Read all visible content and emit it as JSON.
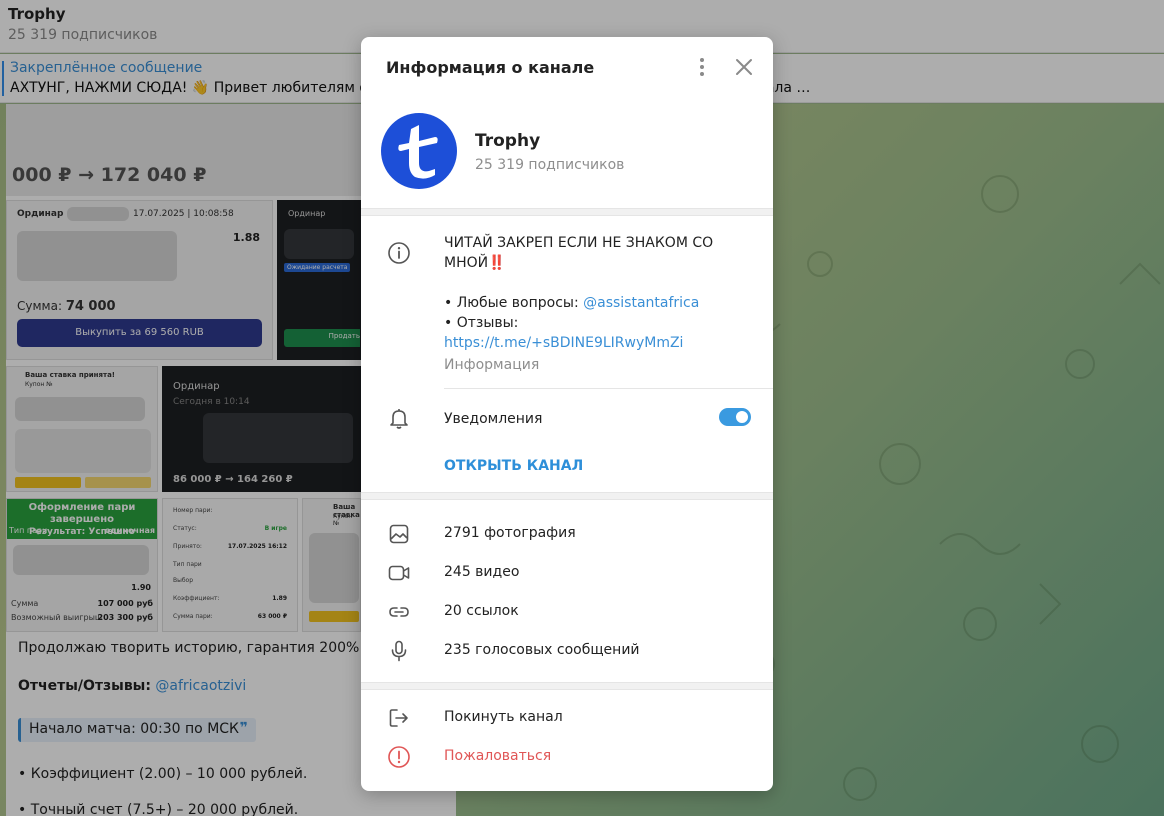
{
  "header": {
    "title": "Trophy",
    "subscribers": "25 319 подписчиков"
  },
  "pinned": {
    "title": "Закреплённое сообщение",
    "text": "АХТУНГ, НАЖМИ СЮДА! 👋 Привет любителям фу… …а. Почему Африканец? Все просто, после скандала …"
  },
  "message": {
    "banner_amount": "000 ₽ → 172 040 ₽",
    "card1": {
      "type": "Ординар",
      "date": "17.07.2025 | 10:08:58",
      "odds": "1.88",
      "sum_label": "Сумма:",
      "sum_value": "74 000",
      "button": "Выкупить за 69 560 RUB"
    },
    "card2": {
      "type": "Ординар",
      "status": "Ожидание расчета",
      "button": "Продать"
    },
    "card3": {
      "title": "Ваша ставка принята!",
      "coupon": "Купон №"
    },
    "card4": {
      "type": "Ординар",
      "date": "Сегодня в 10:14",
      "amount": "86 000 ₽ → 164 260 ₽"
    },
    "card5": {
      "head": "Оформление пари завершено",
      "result_label": "Результат:",
      "result_value": "Успешно",
      "bet_type_label": "Тип пари",
      "bet_type_value": "одиночная",
      "odds": "1.90",
      "sum_label": "Сумма",
      "sum_value": "107 000 руб",
      "win_label": "Возможный выигрыш",
      "win_value": "203 300 руб"
    },
    "card6": {
      "number_label": "Номер пари:",
      "status_label": "Статус:",
      "status_value": "В игре",
      "accepted_label": "Принято:",
      "accepted_value": "17.07.2025 16:12",
      "type_label": "Тип пари",
      "choice_label": "Выбор",
      "coef_label": "Коэффициент:",
      "coef_value": "1.89",
      "sum_label": "Сумма пари:",
      "sum_value": "63 000 ₽"
    },
    "card7": {
      "title": "Ваша ставка...",
      "coupon": "Купон №"
    },
    "line1": "Продолжаю творить историю, гарантия 200% - по",
    "reports_label": "Отчеты/Отзывы:",
    "reports_link": "@africaotzivi",
    "quote": "Начало матча: 00:30 по МСК",
    "line3": "• Коэффициент (2.00) – 10 000 рублей.",
    "line4": "• Точный счет (7.5+) – 20 000 рублей."
  },
  "modal": {
    "title": "Информация о канале",
    "channel_name": "Trophy",
    "channel_subs": "25 319 подписчиков",
    "desc_line1": "ЧИТАЙ ЗАКРЕП ЕСЛИ НЕ ЗНАКОМ СО МНОЙ‼️",
    "desc_q_prefix": "• Любые вопросы:",
    "desc_q_link": "@assistantafrica",
    "desc_r_prefix": "• Отзывы:",
    "desc_r_link": "https://t.me/+sBDINE9LIRwyMmZi",
    "desc_caption": "Информация",
    "notifications": "Уведомления",
    "notifications_on": true,
    "open_channel": "ОТКРЫТЬ КАНАЛ",
    "media": [
      {
        "icon": "photo-icon",
        "label": "2791 фотография"
      },
      {
        "icon": "video-icon",
        "label": "245 видео"
      },
      {
        "icon": "link-icon",
        "label": "20 ссылок"
      },
      {
        "icon": "microphone-icon",
        "label": "235 голосовых сообщений"
      }
    ],
    "leave": "Покинуть канал",
    "report": "Пожаловаться"
  },
  "colors": {
    "accent": "#3a8fd6",
    "danger": "#e05656",
    "avatar": "#1d4fd8"
  }
}
